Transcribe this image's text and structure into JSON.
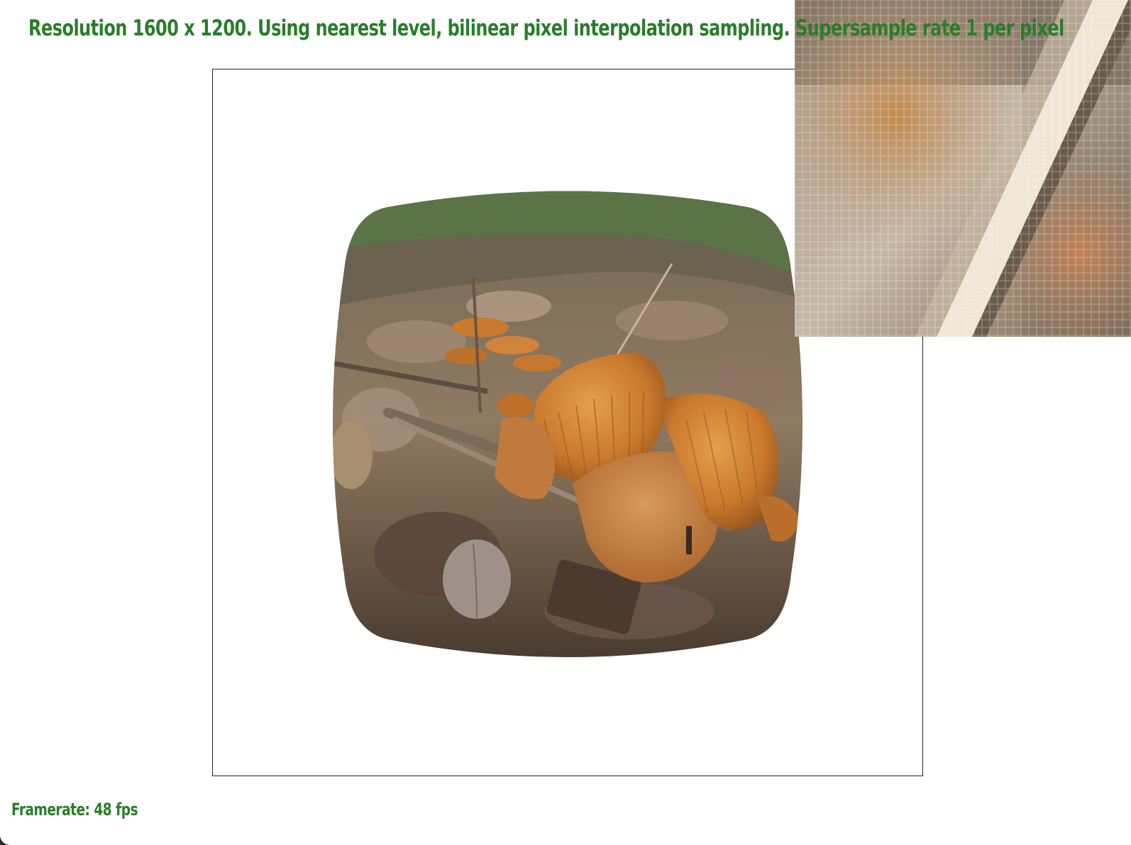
{
  "hud": {
    "status": "Resolution 1600 x 1200. Using nearest level, bilinear pixel interpolation sampling. Supersample rate 1 per pixel",
    "framerate": "Framerate: 48 fps"
  },
  "viewport": {
    "texture_icon": "mushroom-photo-texture",
    "zoom_icon": "magnified-pixel-grid"
  },
  "colors": {
    "hud_text": "#2a7d2a",
    "background": "#ffffff",
    "mushroom": "#c97a2e",
    "foliage": "#5f7a4a",
    "leaf_litter": "#8a7560"
  }
}
